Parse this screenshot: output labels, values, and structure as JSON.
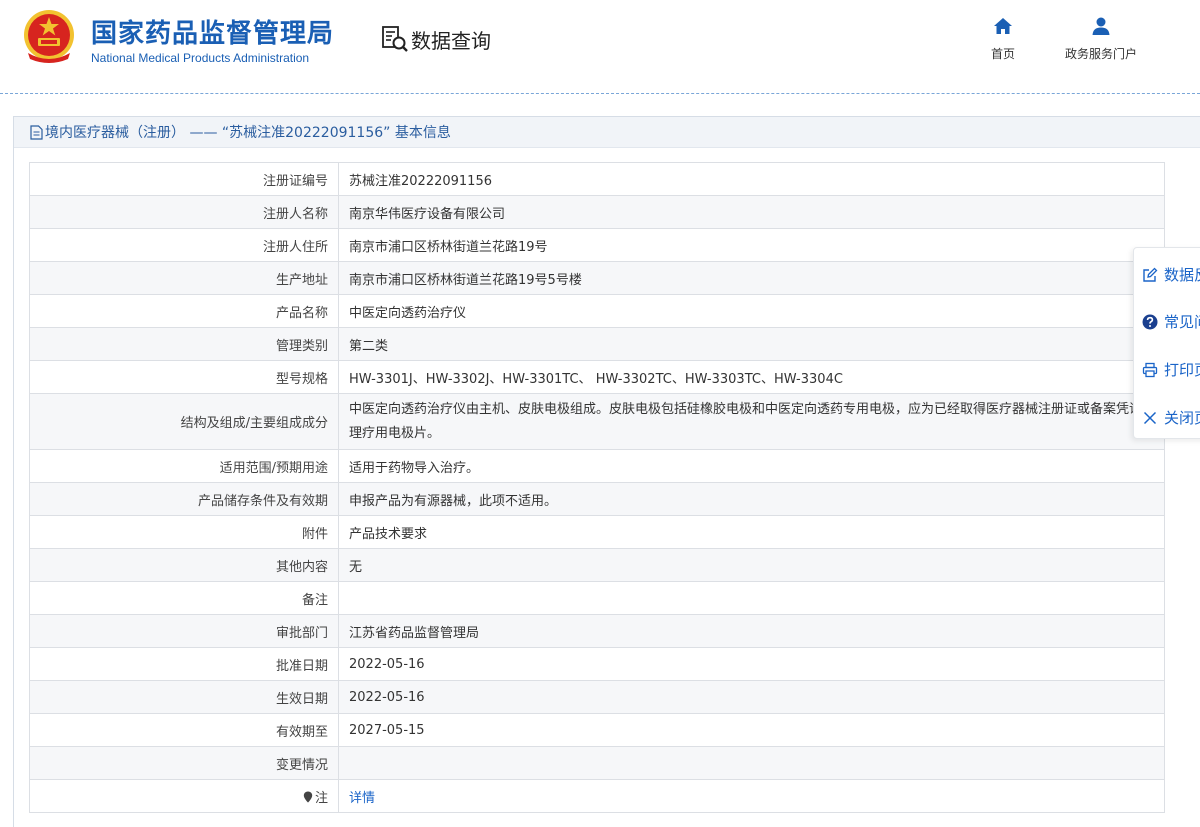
{
  "header": {
    "agency_cn": "国家药品监督管理局",
    "agency_en": "National Medical Products Administration",
    "query_label": "数据查询",
    "nav": [
      {
        "label": "首页",
        "icon": "home-icon"
      },
      {
        "label": "政务服务门户",
        "icon": "user-icon"
      }
    ]
  },
  "panel": {
    "title": "境内医疗器械（注册） —— “苏械注准20222091156” 基本信息"
  },
  "rows": [
    {
      "key": "注册证编号",
      "value": "苏械注准20222091156"
    },
    {
      "key": "注册人名称",
      "value": "南京华伟医疗设备有限公司"
    },
    {
      "key": "注册人住所",
      "value": "南京市浦口区桥林街道兰花路19号"
    },
    {
      "key": "生产地址",
      "value": "南京市浦口区桥林街道兰花路19号5号楼"
    },
    {
      "key": "产品名称",
      "value": "中医定向透药治疗仪"
    },
    {
      "key": "管理类别",
      "value": "第二类"
    },
    {
      "key": "型号规格",
      "value": "HW-3301J、HW-3302J、HW-3301TC、 HW-3302TC、HW-3303TC、HW-3304C"
    },
    {
      "key": "结构及组成/主要组成成分",
      "value": "中医定向透药治疗仪由主机、皮肤电极组成。皮肤电极包括硅橡胶电极和中医定向透药专用电极，应为已经取得医疗器械注册证或备案凭证的理疗用电极片。"
    },
    {
      "key": "适用范围/预期用途",
      "value": "适用于药物导入治疗。"
    },
    {
      "key": "产品储存条件及有效期",
      "value": "申报产品为有源器械，此项不适用。"
    },
    {
      "key": "附件",
      "value": "产品技术要求"
    },
    {
      "key": "其他内容",
      "value": "无"
    },
    {
      "key": "备注",
      "value": ""
    },
    {
      "key": "审批部门",
      "value": "江苏省药品监督管理局"
    },
    {
      "key": "批准日期",
      "value": "2022-05-16"
    },
    {
      "key": "生效日期",
      "value": "2022-05-16"
    },
    {
      "key": "有效期至",
      "value": "2027-05-15"
    },
    {
      "key": "变更情况",
      "value": ""
    },
    {
      "key": "注",
      "value": "详情"
    }
  ],
  "sidebar": {
    "items": [
      {
        "label": "数据反馈",
        "icon": "edit-icon"
      },
      {
        "label": "常见问题",
        "icon": "help-icon"
      },
      {
        "label": "打印页面",
        "icon": "print-icon"
      },
      {
        "label": "关闭页面",
        "icon": "close-icon"
      }
    ]
  },
  "colors": {
    "brand_blue": "#1a5fb4",
    "link_blue": "#1a64c8",
    "emblem_red": "#d7241f",
    "emblem_gold": "#f2c230"
  }
}
